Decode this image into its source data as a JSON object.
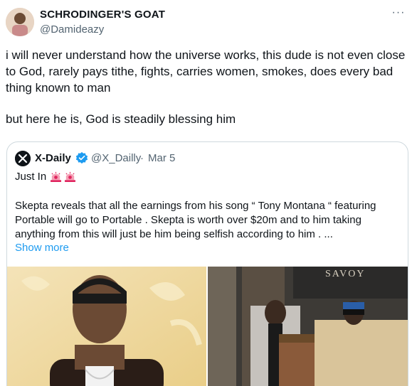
{
  "tweet": {
    "author_name": "SCHRODINGER'S GOAT",
    "author_handle": "@Damideazy",
    "more_label": "···",
    "text_line1": "i will never understand how the universe works, this dude is not even close to God, rarely pays tithe, fights, carries women, smokes, does every bad thing known to man",
    "text_line2": "but here he is, God is steadily blessing him"
  },
  "quote": {
    "author_name": "X-Daily",
    "author_handle": "@X_Dailly",
    "separator": "·",
    "date": "Mar 5",
    "just_in": "Just In",
    "text": "Skepta reveals that all the earnings from his song “ Tony Montana “ featuring Portable will go to Portable .  Skepta is worth over $20m  and to him taking anything from this will just be him being selfish according to him .  ...",
    "show_more": "Show more",
    "sign_text": "SAVOY"
  },
  "icons": {
    "avatar": "user-avatar",
    "quote_avatar": "x-daily-logo",
    "verified": "verified-badge-icon",
    "siren": "police-siren-icon",
    "more": "more-dots-icon"
  },
  "colors": {
    "text": "#0f1419",
    "secondary": "#536471",
    "link": "#1d9bf0",
    "border": "#cfd9de",
    "siren": "#e0245e"
  }
}
